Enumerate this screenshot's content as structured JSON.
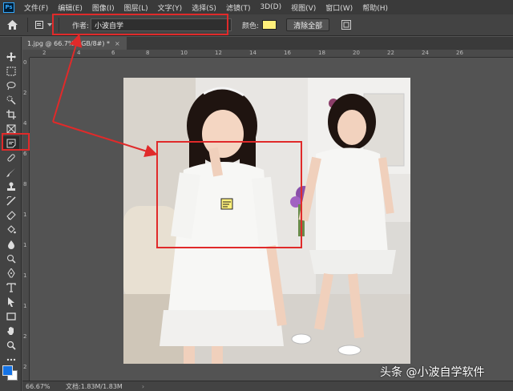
{
  "app": {
    "logo": "Ps"
  },
  "menu": [
    "文件(F)",
    "编辑(E)",
    "图像(I)",
    "图层(L)",
    "文字(Y)",
    "选择(S)",
    "滤镜(T)",
    "3D(D)",
    "视图(V)",
    "窗口(W)",
    "帮助(H)"
  ],
  "options": {
    "author_label": "作者:",
    "author_value": "小波自学",
    "color_label": "颜色:",
    "note_color": "#fff07a",
    "clear_all_label": "清除全部"
  },
  "document": {
    "tab_title": "1.jpg @ 66.7%(RGB/8#) *",
    "close_glyph": "×"
  },
  "ruler_h_labels": [
    "2",
    "4",
    "6",
    "8",
    "10",
    "12",
    "14",
    "16",
    "18",
    "20",
    "22",
    "24",
    "26"
  ],
  "ruler_v_labels": [
    "0",
    "2",
    "4",
    "6",
    "8",
    "1",
    "1",
    "1",
    "1",
    "2",
    "2"
  ],
  "toolbar": {
    "foreground_color": "#1473e6",
    "background_color": "#ffffff",
    "tools": [
      "move-tool",
      "marquee-tool",
      "lasso-tool",
      "quick-select-tool",
      "crop-tool",
      "frame-tool",
      "note-tool",
      "healing-tool",
      "brush-tool",
      "stamp-tool",
      "history-brush-tool",
      "eraser-tool",
      "paint-bucket-tool",
      "blur-tool",
      "dodge-tool",
      "pen-tool",
      "type-tool",
      "path-select-tool",
      "rectangle-tool",
      "hand-tool",
      "zoom-tool",
      "more-tools"
    ]
  },
  "status": {
    "zoom": "66.67%",
    "doc_size": "文档:1.83M/1.83M",
    "arrow": "›"
  },
  "watermark": "头条 @小波自学软件",
  "annotation_color": "#e02a2a"
}
